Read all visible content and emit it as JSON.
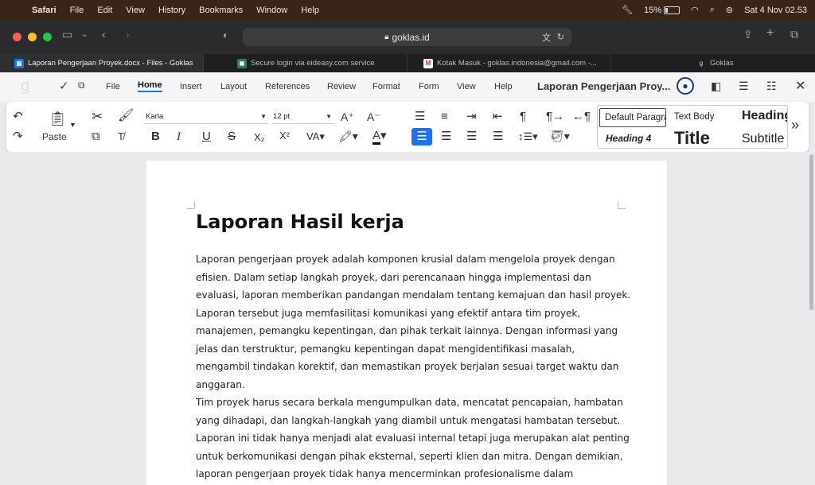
{
  "macos": {
    "app": "Safari",
    "menus": [
      "File",
      "Edit",
      "View",
      "History",
      "Bookmarks",
      "Window",
      "Help"
    ],
    "battery": "15%",
    "datetime": "Sat 4 Nov  02.53"
  },
  "browser": {
    "url": "goklas.id",
    "tabs": [
      {
        "title": "Laporan Pengerjaan Proyek.docx - Files - Goklas",
        "active": true
      },
      {
        "title": "Secure login via eideasy.com service",
        "active": false
      },
      {
        "title": "Kotak Masuk - goklas.indonesia@gmail.com -...",
        "active": false
      },
      {
        "title": "Goklas",
        "active": false
      }
    ]
  },
  "app": {
    "menus": [
      "File",
      "Home",
      "Insert",
      "Layout",
      "References",
      "Review",
      "Format",
      "Form",
      "View",
      "Help"
    ],
    "active_menu": "Home",
    "doc_title": "Laporan Pengerjaan Proy..."
  },
  "ribbon": {
    "paste_label": "Paste",
    "font_name": "Karla",
    "font_size": "12 pt",
    "styles": {
      "default": "Default Paragraph Style",
      "text_body": "Text Body",
      "heading": "Heading",
      "heading4": "Heading 4",
      "title": "Title",
      "subtitle": "Subtitle"
    }
  },
  "document": {
    "heading": "Laporan Hasil kerja",
    "paragraph1": [
      "Laporan pengerjaan proyek adalah komponen krusial dalam mengelola proyek dengan",
      "efisien. Dalam setiap langkah proyek, dari perencanaan hingga implementasi dan",
      "evaluasi, laporan memberikan pandangan mendalam tentang kemajuan dan hasil proyek.",
      "Laporan tersebut juga memfasilitasi komunikasi yang efektif antara tim proyek,",
      "manajemen, pemangku kepentingan, dan pihak terkait lainnya. Dengan informasi yang",
      "jelas dan terstruktur, pemangku kepentingan dapat mengidentifikasi masalah,",
      "mengambil tindakan korektif, dan memastikan proyek berjalan sesuai target waktu dan",
      "anggaran."
    ],
    "paragraph2": [
      "Tim proyek harus secara berkala mengumpulkan data, mencatat pencapaian, hambatan",
      "yang dihadapi, dan langkah-langkah yang diambil untuk mengatasi hambatan tersebut.",
      "Laporan ini tidak hanya menjadi alat evaluasi internal tetapi juga merupakan alat penting",
      "untuk berkomunikasi dengan pihak eksternal, seperti klien dan mitra. Dengan demikian,",
      "laporan pengerjaan proyek tidak hanya mencerminkan profesionalisme dalam"
    ]
  },
  "colors": {
    "menubar_bg": "#3a2418",
    "toolbar_bg": "#2b2b2d",
    "accent": "#1a73e8"
  }
}
